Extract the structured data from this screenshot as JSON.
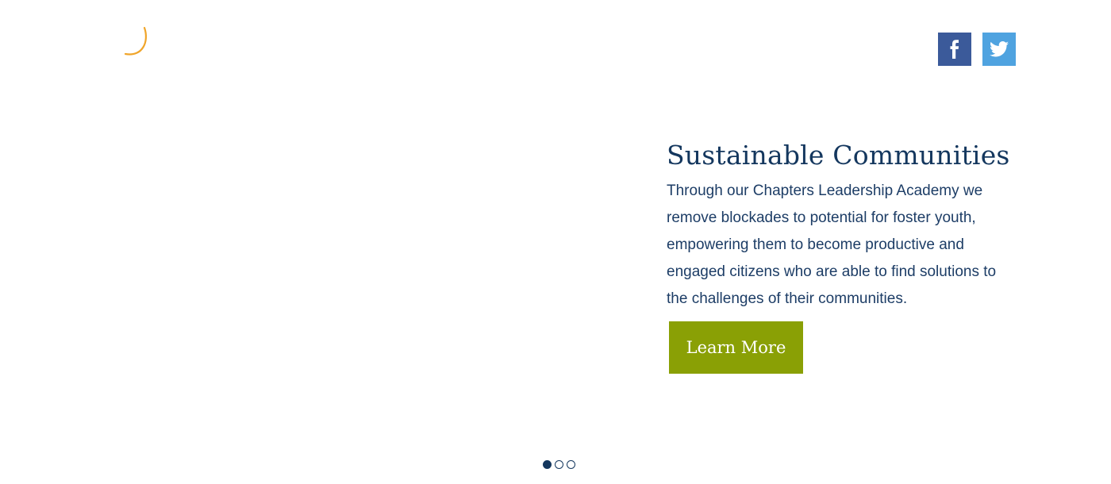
{
  "header": {
    "social": [
      {
        "name": "facebook",
        "icon": "facebook-icon",
        "color": "#3b5a9a"
      },
      {
        "name": "twitter",
        "icon": "twitter-icon",
        "color": "#4fa3e0"
      }
    ]
  },
  "slide": {
    "title": "Sustainable Communities",
    "text": "Through our Chapters Leadership Academy we remove blockades to potential for foster youth, empowering them to become productive and engaged citizens who are able to find solutions to the challenges of their communities.",
    "button_label": "Learn More"
  },
  "carousel": {
    "slide_count": 3,
    "active_index": 0
  },
  "colors": {
    "title": "#14375e",
    "text": "#1d3d66",
    "button": "#8aa005",
    "logo_accent": "#f0a52a"
  }
}
